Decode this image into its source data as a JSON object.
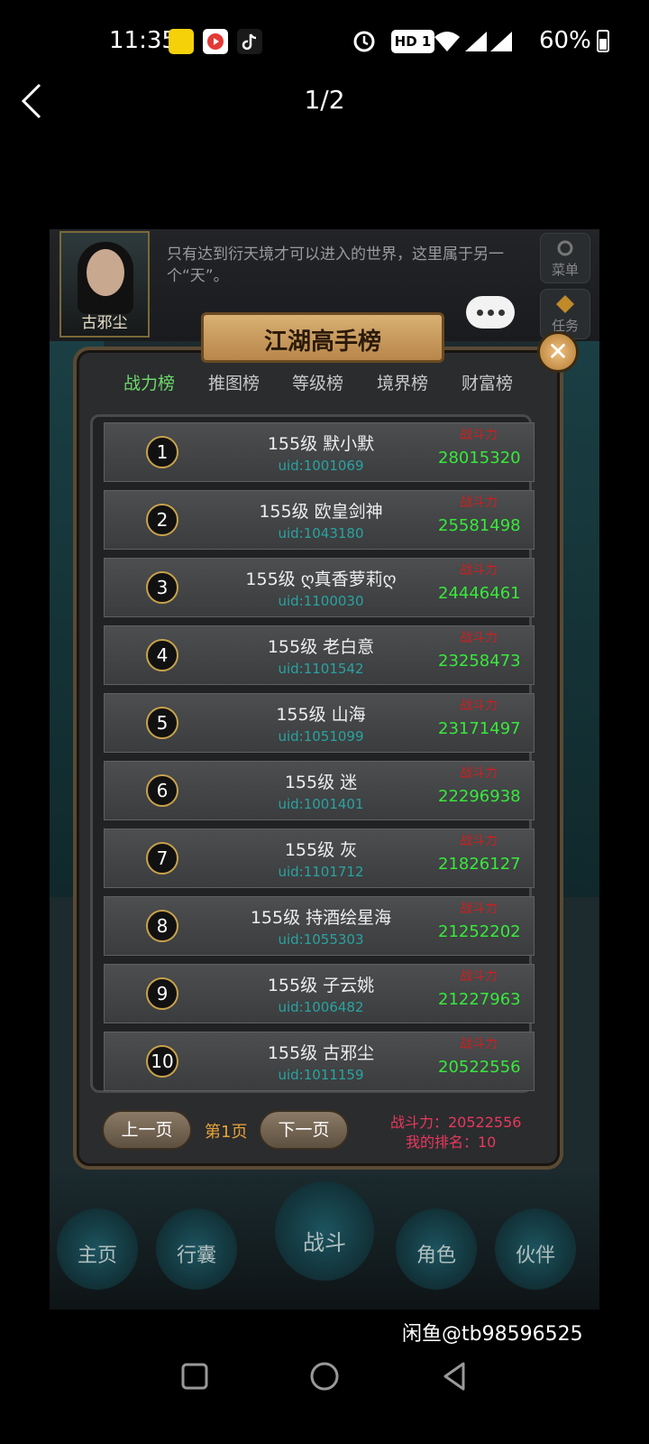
{
  "status_bar": {
    "time": "11:35",
    "hd_badge": "HD 1",
    "battery": "60%"
  },
  "top_nav": {
    "page_indicator": "1/2"
  },
  "game": {
    "portrait_name": "古邪尘",
    "intro_text": "只有达到衍天境才可以进入的世界，这里属于另一个“天”。",
    "side_menu": "菜单",
    "side_task": "任务",
    "title": "江湖高手榜",
    "tabs": [
      {
        "label": "战力榜"
      },
      {
        "label": "推图榜"
      },
      {
        "label": "等级榜"
      },
      {
        "label": "境界榜"
      },
      {
        "label": "财富榜"
      }
    ],
    "power_label": "战斗力",
    "rows": [
      {
        "rank": "1",
        "name": "155级 默小默",
        "uid": "uid:1001069",
        "power": "28015320"
      },
      {
        "rank": "2",
        "name": "155级 欧皇剑神",
        "uid": "uid:1043180",
        "power": "25581498"
      },
      {
        "rank": "3",
        "name": "155级 ღ真香萝莉ღ",
        "uid": "uid:1100030",
        "power": "24446461"
      },
      {
        "rank": "4",
        "name": "155级 老白意",
        "uid": "uid:1101542",
        "power": "23258473"
      },
      {
        "rank": "5",
        "name": "155级 山海",
        "uid": "uid:1051099",
        "power": "23171497"
      },
      {
        "rank": "6",
        "name": "155级 迷",
        "uid": "uid:1001401",
        "power": "22296938"
      },
      {
        "rank": "7",
        "name": "155级 灰",
        "uid": "uid:1101712",
        "power": "21826127"
      },
      {
        "rank": "8",
        "name": "155级 持酒绘星海",
        "uid": "uid:1055303",
        "power": "21252202"
      },
      {
        "rank": "9",
        "name": "155级 子云姚",
        "uid": "uid:1006482",
        "power": "21227963"
      },
      {
        "rank": "10",
        "name": "155级 古邪尘",
        "uid": "uid:1011159",
        "power": "20522556"
      }
    ],
    "prev_page": "上一页",
    "current_page": "第1页",
    "next_page": "下一页",
    "my_power": "战斗力：20522556",
    "my_rank": "我的排名：10",
    "bottom_nav": [
      "主页",
      "行囊",
      "战斗",
      "角色",
      "伙伴"
    ]
  },
  "watermark": "闲鱼@tb98596525",
  "colors": {
    "power_value": "#39e83c",
    "power_label": "#d01e1e",
    "uid": "#2aa3a0",
    "active_tab": "#6cd96a"
  }
}
